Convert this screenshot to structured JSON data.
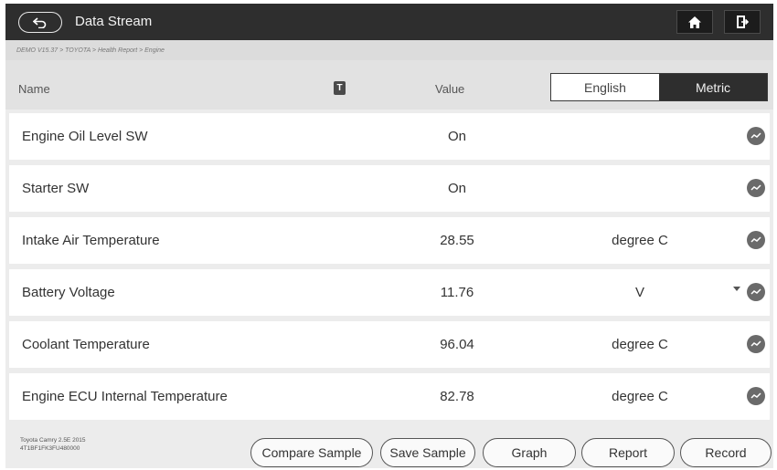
{
  "topbar": {
    "title": "Data Stream",
    "icons": {
      "back": "back-arrow-icon",
      "home": "home-icon",
      "exit": "exit-icon"
    }
  },
  "breadcrumb": "DEMO V15.37 > TOYOTA > Health Report > Engine",
  "header": {
    "name_label": "Name",
    "t_icon": "T",
    "value_label": "Value",
    "unit_options": [
      "English",
      "Metric"
    ],
    "selected_unit": "Metric"
  },
  "rows": [
    {
      "name": "Engine Oil Level SW",
      "value": "On",
      "unit": ""
    },
    {
      "name": "Starter SW",
      "value": "On",
      "unit": ""
    },
    {
      "name": "Intake Air Temperature",
      "value": "28.55",
      "unit": "degree C"
    },
    {
      "name": "Battery Voltage",
      "value": "11.76",
      "unit": "V"
    },
    {
      "name": "Coolant Temperature",
      "value": "96.04",
      "unit": "degree C"
    },
    {
      "name": "Engine ECU Internal Temperature",
      "value": "82.78",
      "unit": "degree C"
    }
  ],
  "footer": {
    "vehicle_line1": "Toyota Camry 2.5E 2015",
    "vehicle_line2": "4T1BF1FK3FU480000",
    "buttons": {
      "compare": "Compare Sample",
      "save": "Save Sample",
      "graph": "Graph",
      "report": "Report",
      "record": "Record"
    }
  },
  "colors": {
    "bar": "#2e2e2e",
    "background": "#ececec",
    "row": "#ffffff",
    "icon": "#6a6a6a"
  }
}
